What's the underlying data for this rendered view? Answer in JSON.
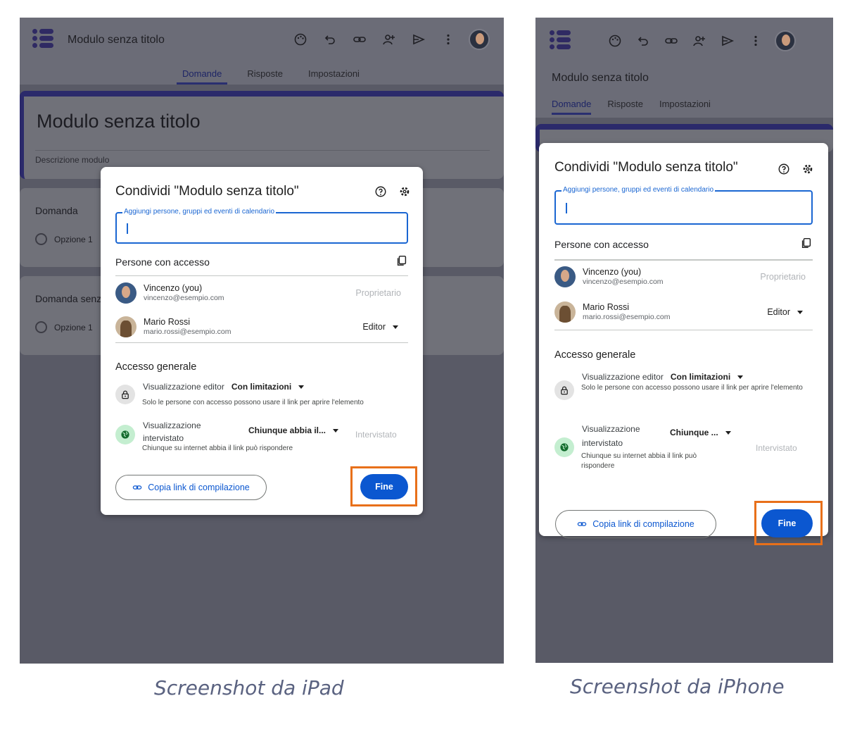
{
  "app": {
    "title": "Modulo senza titolo",
    "tabs": [
      "Domande",
      "Risposte",
      "Impostazioni"
    ],
    "toolbar_icons": [
      "palette-icon",
      "undo-icon",
      "link-icon",
      "add-collaborator-icon",
      "send-icon",
      "more-vert-icon"
    ]
  },
  "form": {
    "title": "Modulo senza titolo",
    "description_placeholder": "Descrizione modulo",
    "questions": [
      {
        "title": "Domanda",
        "option": "Opzione 1"
      },
      {
        "title": "Domanda senza titolo",
        "option": "Opzione 1"
      }
    ]
  },
  "dialog": {
    "title": "Condividi \"Modulo senza titolo\"",
    "add_label": "Aggiungi persone, gruppi ed eventi di calendario",
    "people_header": "Persone con accesso",
    "people": [
      {
        "name": "Vincenzo (you)",
        "email": "vincenzo@esempio.com",
        "role": "Proprietario"
      },
      {
        "name": "Mario Rossi",
        "email": "mario.rossi@esempio.com",
        "role": "Editor"
      }
    ],
    "general_access_header": "Accesso generale",
    "editor_view": {
      "label": "Visualizzazione editor",
      "value": "Con limitazioni",
      "description": "Solo le persone con accesso possono usare il link per aprire l'elemento"
    },
    "respondent_view": {
      "label": "Visualizzazione intervistato",
      "value_ipad": "Chiunque abbia il...",
      "value_iphone": "Chiunque ...",
      "role": "Intervistato",
      "description": "Chiunque su internet abbia il link può rispondere"
    },
    "copy_link_label": "Copia link di compilazione",
    "done_label": "Fine"
  },
  "captions": {
    "ipad": "Screenshot da iPad",
    "iphone": "Screenshot da iPhone"
  },
  "colors": {
    "accent": "#0b57d0",
    "highlight": "#e8701a",
    "overlay": "#595a66"
  }
}
